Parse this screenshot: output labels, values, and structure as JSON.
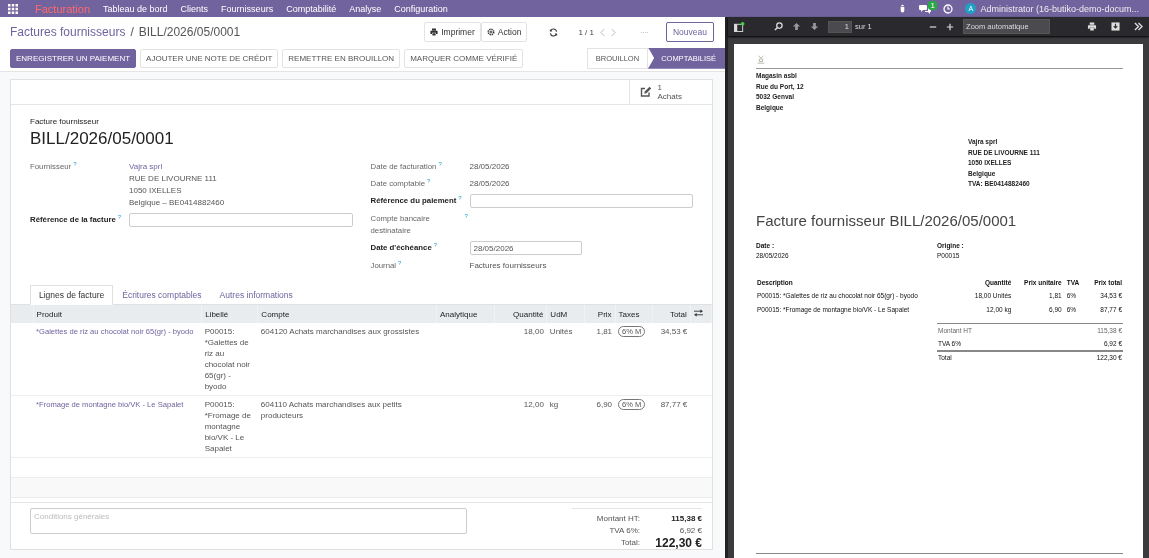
{
  "topbar": {
    "app": "Facturation",
    "menu": [
      "Tableau de bord",
      "Clients",
      "Fournisseurs",
      "Comptabilité",
      "Analyse",
      "Configuration"
    ],
    "messages_badge": "1",
    "user_initial": "A",
    "user": "Administrator (16-butiko-demo-docum..."
  },
  "breadcrumb": {
    "parent": "Factures fournisseurs",
    "separator": "/",
    "current": "BILL/2026/05/0001"
  },
  "actions": [
    "Imprimer",
    "Action"
  ],
  "pager": "1 / 1",
  "new_button": "Nouveau",
  "buttons": [
    {
      "label": "ENREGISTRER UN PAIEMENT",
      "primary": true
    },
    {
      "label": "AJOUTER UNE NOTE DE CRÉDIT",
      "primary": false
    },
    {
      "label": "REMETTRE EN BROUILLON",
      "primary": false
    },
    {
      "label": "MARQUER COMME VÉRIFIÉ",
      "primary": false
    }
  ],
  "statusbar": [
    {
      "label": "BROUILLON",
      "selected": false
    },
    {
      "label": "COMPTABILISÉ",
      "selected": true
    }
  ],
  "smart_button": {
    "count": "1",
    "label": "Achats"
  },
  "form": {
    "type_label": "Facture fournisseur",
    "name": "BILL/2026/05/0001",
    "left_fields": [
      {
        "label": "Fournisseur",
        "hint": "?",
        "kind": "address",
        "required": false,
        "lines": [
          "Vajra sprl",
          "RUE DE LIVOURNE 111",
          "1050 IXELLES",
          "Belgique – BE0414882460"
        ]
      },
      {
        "label": "Référence de la facture",
        "hint": "?",
        "kind": "input",
        "required": true
      }
    ],
    "right_fields": [
      {
        "label": "Date de facturation",
        "hint": "?",
        "kind": "text",
        "required": false,
        "value": "28/05/2026"
      },
      {
        "label": "Date comptable",
        "hint": "?",
        "kind": "text",
        "required": false,
        "value": "28/05/2026"
      },
      {
        "label": "Référence du paiement",
        "hint": "?",
        "kind": "input",
        "required": true
      },
      {
        "label": "Compte bancaire destinataire",
        "hint": "?",
        "kind": "text",
        "required": false
      },
      {
        "label": "Date d'échéance",
        "hint": "?",
        "kind": "date",
        "required": true,
        "value": "28/05/2026"
      },
      {
        "label": "Journal",
        "hint": "?",
        "kind": "text",
        "required": false,
        "value": "Factures fournisseurs"
      }
    ]
  },
  "tabs": [
    {
      "label": "Lignes de facture",
      "selected": true
    },
    {
      "label": "Écritures comptables",
      "selected": false
    },
    {
      "label": "Autres informations",
      "selected": false
    }
  ],
  "table": {
    "columns": [
      "Produit",
      "Libellé",
      "Compte",
      "Analytique",
      "Quantité",
      "UdM",
      "Prix",
      "Taxes",
      "Total"
    ],
    "rows": [
      {
        "product": "*Galettes de riz au chocolat noir 65(gr) - byodo",
        "label": "P00015: *Galettes de riz au chocolat noir 65(gr) - byodo",
        "account": "604120 Achats marchandises aux grossistes",
        "quantity": "18,00",
        "uom": "Unités",
        "price": "1,81",
        "taxes": "6% M",
        "total": "34,53 €"
      },
      {
        "product": "*Fromage de montagne bio/VK - Le Sapalet",
        "label": "P00015: *Fromage de montagne bio/VK - Le Sapalet",
        "account": "604110 Achats marchandises aux petits producteurs",
        "quantity": "12,00",
        "uom": "kg",
        "price": "6,90",
        "taxes": "6% M",
        "total": "87,77 €"
      }
    ]
  },
  "terms": {
    "placeholder": "Conditions générales"
  },
  "totals": [
    {
      "kind": "subtotal",
      "label": "Montant HT:",
      "value": "115,38 €"
    },
    {
      "kind": "tax",
      "label": "TVA 6%:",
      "value": "6,92 €"
    },
    {
      "kind": "total",
      "label": "Total:",
      "value": "122,30 €"
    }
  ],
  "pdf_viewer": {
    "page": "1",
    "page_count": "sur 1",
    "zoom": "Zoom automatique",
    "document": {
      "company": [
        "Magasin asbl",
        "Rue du Port, 12",
        "5032 Genval",
        "Belgique"
      ],
      "partner": [
        "Vajra sprl",
        "RUE DE LIVOURNE 111",
        "1050 IXELLES",
        "Belgique",
        "TVA: BE0414882460"
      ],
      "title": "Facture fournisseur BILL/2026/05/0001",
      "info": [
        {
          "label": "Date :",
          "value": "28/05/2026"
        },
        {
          "label": "Origine :",
          "value": "P00015"
        }
      ],
      "columns": [
        "Description",
        "Quantité",
        "Prix unitaire",
        "TVA",
        "Prix total"
      ],
      "rows": [
        [
          "P00015: *Galettes de riz au chocolat noir 65(gr) - byodo",
          "18,00 Unités",
          "1,81",
          "6%",
          "34,53 €"
        ],
        [
          "P00015: *Fromage de montagne bio/VK - Le Sapalet",
          "12,00 kg",
          "6,90",
          "6%",
          "87,77 €"
        ]
      ],
      "totals": [
        {
          "kind": "subtotal",
          "label": "Montant HT",
          "value": "115,38 €"
        },
        {
          "kind": "tax",
          "label": "TVA 6%",
          "value": "6,92 €"
        },
        {
          "kind": "total",
          "label": "Total",
          "value": "122,30 €"
        }
      ]
    }
  }
}
